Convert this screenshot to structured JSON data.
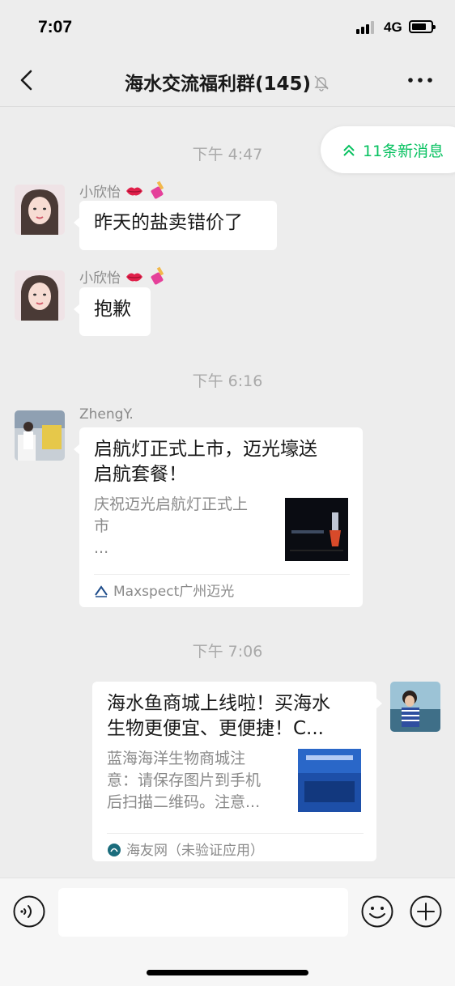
{
  "status": {
    "time": "7:07",
    "network": "4G"
  },
  "nav": {
    "title": "海水交流福利群(145)"
  },
  "new_messages": {
    "label": "11条新消息"
  },
  "messages": [
    {
      "time": "下午 4:47",
      "sender": "小欣怡",
      "text": "昨天的盐卖错价了"
    },
    {
      "sender": "小欣怡",
      "text": "抱歉"
    },
    {
      "time": "下午 6:16",
      "sender": "ZhengY.",
      "card": {
        "title": "启航灯正式上市，迈光壕送启航套餐！",
        "title_line1": "启航灯正式上市，迈光壕送",
        "title_line2": "启航套餐！",
        "desc_line1": "庆祝迈光启航灯正式上",
        "desc_line2": "市",
        "desc_line3": "...",
        "source": "Maxspect广州迈光"
      }
    },
    {
      "time": "下午 7:06",
      "card": {
        "title_line1": "海水鱼商城上线啦！买海水",
        "title_line2": "生物更便宜、更便捷！C...",
        "desc_line1": "蓝海海洋生物商城注",
        "desc_line2": "意：请保存图片到手机",
        "desc_line3": "后扫描二维码。注意...",
        "source": "海友网（未验证应用）"
      }
    }
  ],
  "icons": {
    "back": "chevron-left-icon",
    "mute": "bell-off-icon",
    "more": "more-dots-icon",
    "voice": "voice-icon",
    "emoji": "smiley-icon",
    "plus": "plus-icon"
  },
  "colors": {
    "accent": "#07c160",
    "background": "#ededed",
    "bubble": "#ffffff"
  },
  "input": {
    "value": ""
  }
}
